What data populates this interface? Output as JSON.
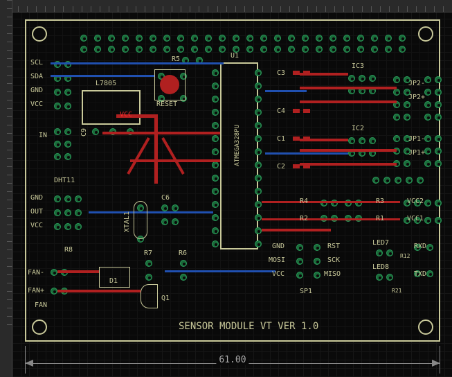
{
  "board": {
    "title": "SENSOR MODULE VT VER 1.0",
    "width_mm": "61.00",
    "chip_label": "ATMEGA328PU"
  },
  "labels": {
    "scl": "SCL",
    "sda": "SDA",
    "gnd1": "GND",
    "vcc1": "VCC",
    "in": "IN",
    "l7805": "L7805",
    "reset": "RESET",
    "r5": "R5",
    "u1": "U1",
    "c3": "C3",
    "c4": "C4",
    "c1": "C1",
    "c2": "C2",
    "ic3": "IC3",
    "ic2": "IC2",
    "dht11": "DHT11",
    "gnd2": "GND",
    "out": "OUT",
    "vcc2": "VCC",
    "r8": "R8",
    "xtal1": "XTAL1",
    "c6": "C6",
    "r7": "R7",
    "r6": "R6",
    "r4": "R4",
    "r2": "R2",
    "r3": "R3",
    "r1": "R1",
    "vcc2_r": "VCC2",
    "vcc1_r": "VCC1",
    "led7": "LED7",
    "led8": "LED8",
    "rxd": "RXD",
    "txd": "TXD",
    "r12": "R12",
    "r21": "R21",
    "gnd3": "GND",
    "mosi": "MOSI",
    "vcc3": "VCC",
    "rst": "RST",
    "sck": "SCK",
    "miso": "MISO",
    "sp1": "SP1",
    "fan_m": "FAN-",
    "fan_p": "FAN+",
    "fan": "FAN",
    "d1": "D1",
    "q1": "Q1",
    "c9": "C9",
    "jp2m": "JP2-",
    "jp2p": "JP2+",
    "jp1m": "JP1-",
    "jp1p": "JP1+",
    "vcc_red": "VCC"
  }
}
